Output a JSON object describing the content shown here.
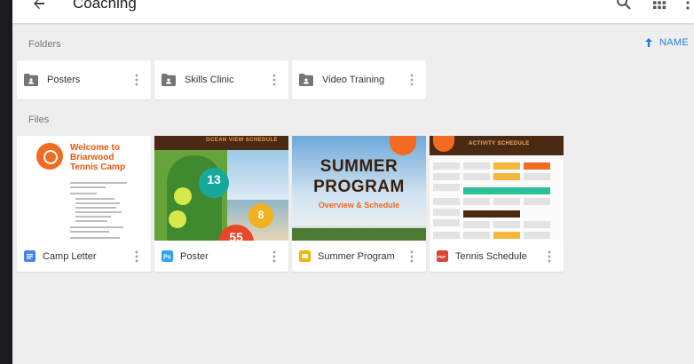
{
  "appbar": {
    "title": "Coaching"
  },
  "sections": {
    "folders_label": "Folders",
    "files_label": "Files"
  },
  "sort": {
    "label": "NAME"
  },
  "folders": [
    {
      "name": "Posters"
    },
    {
      "name": "Skills Clinic"
    },
    {
      "name": "Video Training"
    }
  ],
  "files": [
    {
      "name": "Camp Letter",
      "type_icon": "google-docs-icon",
      "type_color": "#4285f4"
    },
    {
      "name": "Poster",
      "type_icon": "photoshop-icon",
      "type_color": "#2fa3f0",
      "type_text": "Ps"
    },
    {
      "name": "Summer Program",
      "type_icon": "google-slides-icon",
      "type_color": "#f4b400"
    },
    {
      "name": "Tennis Schedule",
      "type_icon": "pdf-icon",
      "type_color": "#db4437",
      "type_text": "PDF"
    }
  ],
  "thumbs": {
    "letter_title": "Welcome to Briarwood Tennis Camp",
    "poster_header": "OCEAN VIEW SCHEDULE",
    "poster_badge_1": "13",
    "poster_badge_2": "8",
    "poster_badge_3": "55",
    "summer_line1": "SUMMER",
    "summer_line2": "PROGRAM",
    "summer_line3": "Overview & Schedule",
    "schedule_header": "ACTIVITY SCHEDULE"
  },
  "colors": {
    "accent": "#2a7de1",
    "brand_orange": "#f36a21",
    "brand_brown": "#4a2a12"
  }
}
